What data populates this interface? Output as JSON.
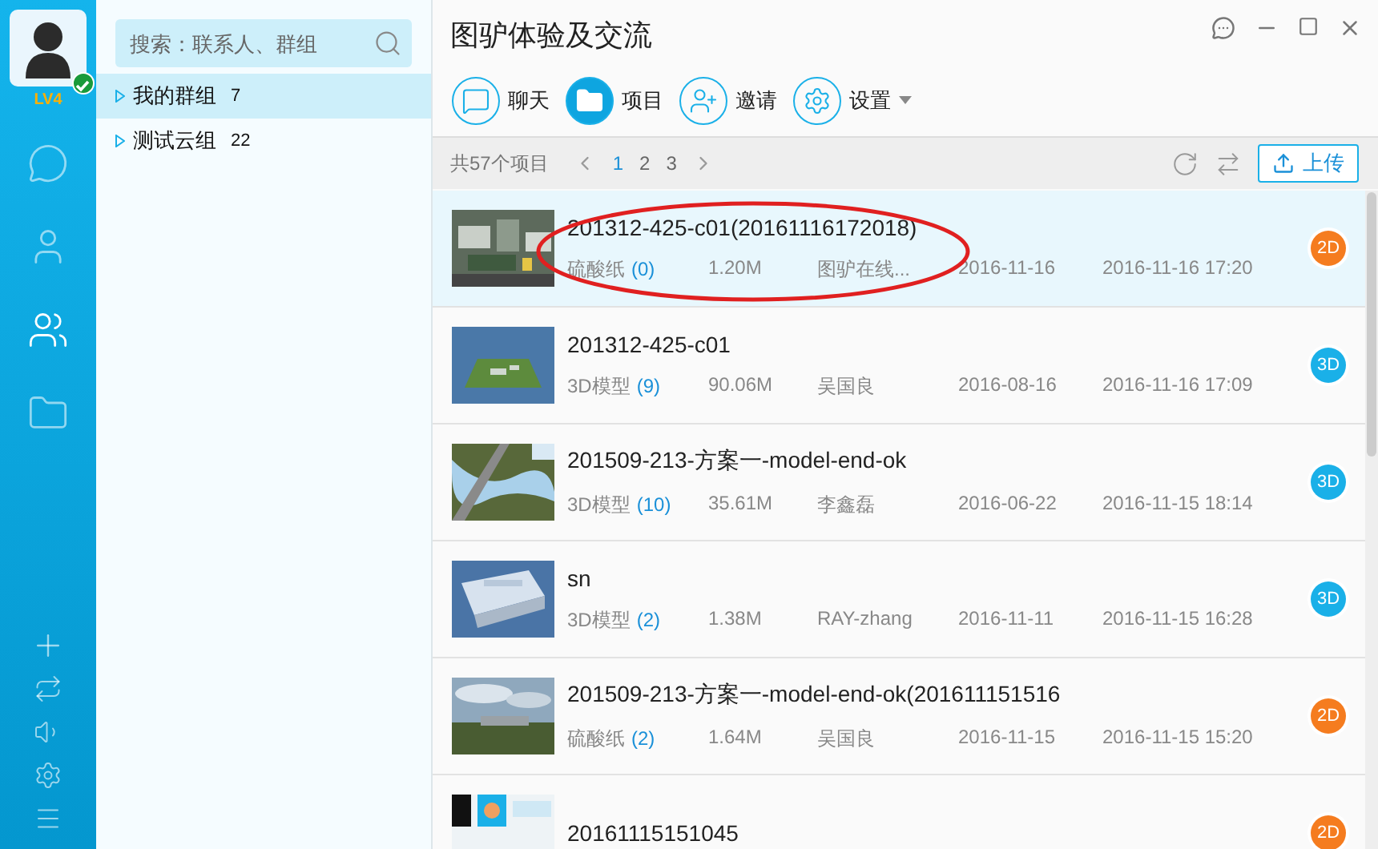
{
  "user": {
    "level": "LV4",
    "online": true
  },
  "nav": [
    {
      "kind": "chat",
      "selected": false
    },
    {
      "kind": "contact",
      "selected": false
    },
    {
      "kind": "groups",
      "selected": true
    },
    {
      "kind": "folder",
      "selected": false
    }
  ],
  "nav_bottom": [
    {
      "kind": "add"
    },
    {
      "kind": "sync"
    },
    {
      "kind": "sound"
    },
    {
      "kind": "settings"
    },
    {
      "kind": "menu"
    }
  ],
  "search": {
    "placeholder": "搜索：联系人、群组"
  },
  "groups": [
    {
      "name": "我的群组",
      "count": "7",
      "selected": true
    },
    {
      "name": "测试云组",
      "count": "22",
      "selected": false
    }
  ],
  "window": {
    "title": "图驴体验及交流"
  },
  "toolbar": [
    {
      "kind": "chat",
      "label": "聊天",
      "selected": false,
      "dropdown": false
    },
    {
      "kind": "folder",
      "label": "项目",
      "selected": true,
      "dropdown": false
    },
    {
      "kind": "invite",
      "label": "邀请",
      "selected": false,
      "dropdown": false
    },
    {
      "kind": "settings",
      "label": "设置",
      "selected": false,
      "dropdown": true
    }
  ],
  "pager": {
    "total": "共57个项目",
    "pages": [
      {
        "label": "1",
        "selected": true
      },
      {
        "label": "2",
        "selected": false
      },
      {
        "label": "3",
        "selected": false
      }
    ]
  },
  "upload": {
    "label": "上传"
  },
  "items": [
    {
      "title": "201312-425-c01(20161116172018)",
      "type": "硫酸纸",
      "count": "(0)",
      "size": "1.20M",
      "owner": "图驴在线...",
      "created": "2016-11-16",
      "modified": "2016-11-16 17:20",
      "badge": "2D",
      "color": "#f57c1f",
      "selected": true,
      "circled": true
    },
    {
      "title": "201312-425-c01",
      "type": "3D模型",
      "count": "(9)",
      "size": "90.06M",
      "owner": "吴国良",
      "created": "2016-08-16",
      "modified": "2016-11-16 17:09",
      "badge": "3D",
      "color": "#1ab0e8",
      "selected": false,
      "circled": false
    },
    {
      "title": "201509-213-方案一-model-end-ok",
      "type": "3D模型",
      "count": "(10)",
      "size": "35.61M",
      "owner": "李鑫磊",
      "created": "2016-06-22",
      "modified": "2016-11-15 18:14",
      "badge": "3D",
      "color": "#1ab0e8",
      "selected": false,
      "circled": false
    },
    {
      "title": "sn",
      "type": "3D模型",
      "count": "(2)",
      "size": "1.38M",
      "owner": "RAY-zhang",
      "created": "2016-11-11",
      "modified": "2016-11-15 16:28",
      "badge": "3D",
      "color": "#1ab0e8",
      "selected": false,
      "circled": false
    },
    {
      "title": "201509-213-方案一-model-end-ok(201611151516",
      "type": "硫酸纸",
      "count": "(2)",
      "size": "1.64M",
      "owner": "吴国良",
      "created": "2016-11-15",
      "modified": "2016-11-15 15:20",
      "badge": "2D",
      "color": "#f57c1f",
      "selected": false,
      "circled": false
    },
    {
      "title": "20161115151045",
      "badge": "2D",
      "color": "#f57c1f",
      "selected": false,
      "circled": false
    }
  ]
}
